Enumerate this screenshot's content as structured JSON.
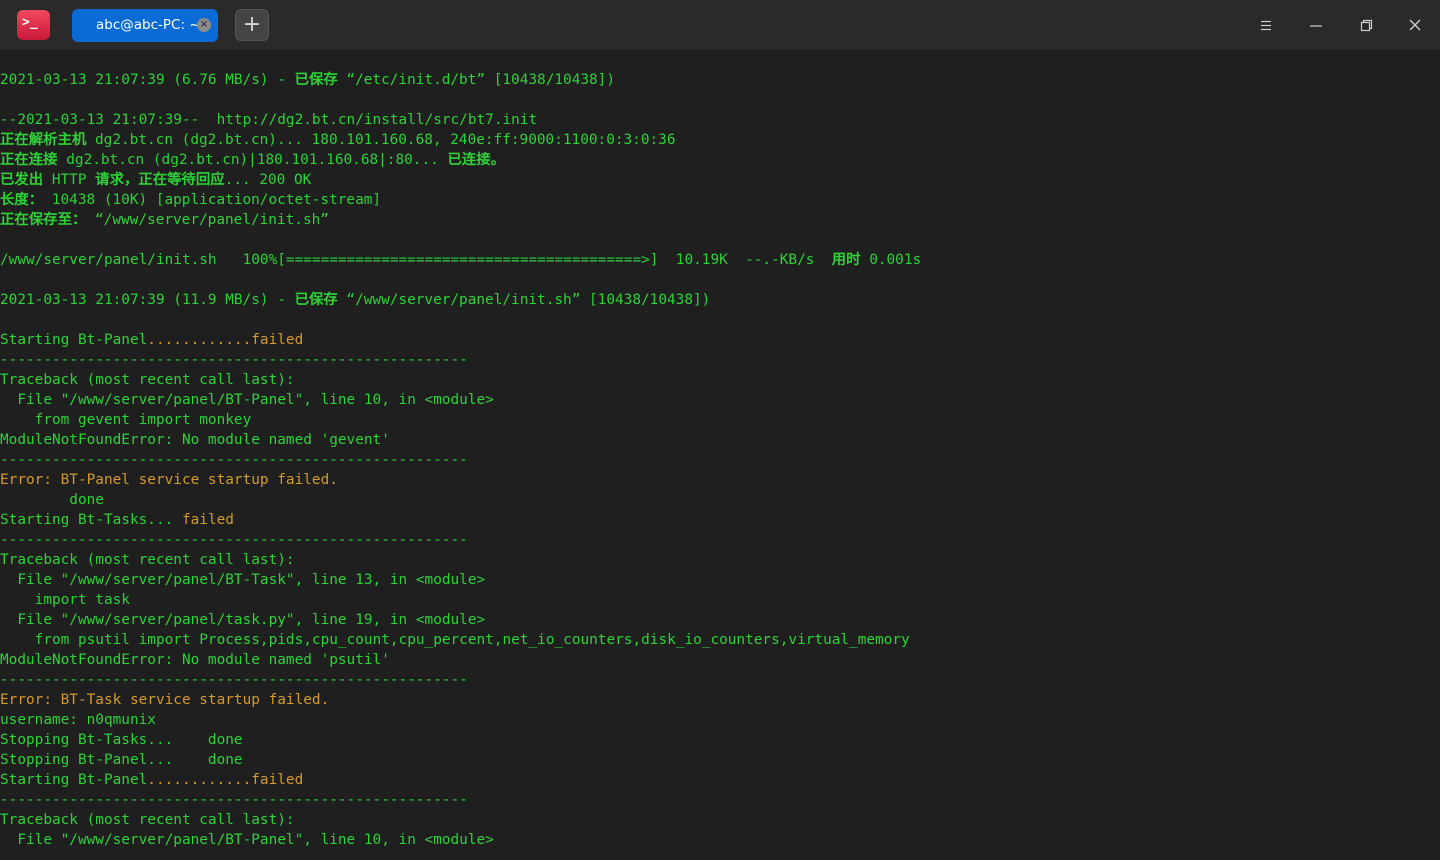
{
  "window": {
    "tab_title": "abc@abc-PC: ~",
    "tab_close_glyph": "×",
    "add_tab_glyph": "+",
    "app_icon_glyph": ">_",
    "colors": {
      "tab_active": "#0b6bd6",
      "terminal_bg": "#1f1f1f",
      "text_green": "#2dd237",
      "text_orange": "#d39a2a"
    }
  },
  "terminal": {
    "lines": [
      [],
      [
        {
          "t": "2021-03-13 21:07:39 (6.76 MB/s) - "
        },
        {
          "t": "已保存",
          "b": 1
        },
        {
          "t": " “/etc/init.d/bt” [10438/10438])"
        }
      ],
      [],
      [
        {
          "t": "--2021-03-13 21:07:39--  http://dg2.bt.cn/install/src/bt7.init"
        }
      ],
      [
        {
          "t": "正在解析主机",
          "b": 1
        },
        {
          "t": " dg2.bt.cn (dg2.bt.cn)... 180.101.160.68, 240e:ff:9000:1100:0:3:0:36"
        }
      ],
      [
        {
          "t": "正在连接",
          "b": 1
        },
        {
          "t": " dg2.bt.cn (dg2.bt.cn)|180.101.160.68|:80... "
        },
        {
          "t": "已连接。",
          "b": 1
        }
      ],
      [
        {
          "t": "已发出",
          "b": 1
        },
        {
          "t": " HTTP "
        },
        {
          "t": "请求，正在等待回应",
          "b": 1
        },
        {
          "t": "... 200 OK"
        }
      ],
      [
        {
          "t": "长度：",
          "b": 1
        },
        {
          "t": " 10438 (10K) [application/octet-stream]"
        }
      ],
      [
        {
          "t": "正在保存至：",
          "b": 1
        },
        {
          "t": " “/www/server/panel/init.sh”"
        }
      ],
      [],
      [
        {
          "t": "/www/server/panel/init.sh   100%[=========================================>]  10.19K  --.-KB/s  "
        },
        {
          "t": "用时",
          "b": 1
        },
        {
          "t": " 0.001s"
        }
      ],
      [],
      [
        {
          "t": "2021-03-13 21:07:39 (11.9 MB/s) - "
        },
        {
          "t": "已保存",
          "b": 1
        },
        {
          "t": " “/www/server/panel/init.sh” [10438/10438])"
        }
      ],
      [],
      [
        {
          "t": "Starting Bt-Panel"
        },
        {
          "t": "............failed",
          "c": "o"
        }
      ],
      [
        {
          "t": "------------------------------------------------------"
        }
      ],
      [
        {
          "t": "Traceback (most recent call last):"
        }
      ],
      [
        {
          "t": "  File \"/www/server/panel/BT-Panel\", line 10, in <module>"
        }
      ],
      [
        {
          "t": "    from gevent import monkey"
        }
      ],
      [
        {
          "t": "ModuleNotFoundError: No module named 'gevent'"
        }
      ],
      [
        {
          "t": "------------------------------------------------------"
        }
      ],
      [
        {
          "t": "Error: BT-Panel service startup failed.",
          "c": "o"
        }
      ],
      [
        {
          "t": "        done"
        }
      ],
      [
        {
          "t": "Starting Bt-Tasks... "
        },
        {
          "t": "failed",
          "c": "o"
        }
      ],
      [
        {
          "t": "------------------------------------------------------"
        }
      ],
      [
        {
          "t": "Traceback (most recent call last):"
        }
      ],
      [
        {
          "t": "  File \"/www/server/panel/BT-Task\", line 13, in <module>"
        }
      ],
      [
        {
          "t": "    import task"
        }
      ],
      [
        {
          "t": "  File \"/www/server/panel/task.py\", line 19, in <module>"
        }
      ],
      [
        {
          "t": "    from psutil import Process,pids,cpu_count,cpu_percent,net_io_counters,disk_io_counters,virtual_memory"
        }
      ],
      [
        {
          "t": "ModuleNotFoundError: No module named 'psutil'"
        }
      ],
      [
        {
          "t": "------------------------------------------------------"
        }
      ],
      [
        {
          "t": "Error: BT-Task service startup failed.",
          "c": "o"
        }
      ],
      [
        {
          "t": "username: n0qmunix"
        }
      ],
      [
        {
          "t": "Stopping Bt-Tasks...    done"
        }
      ],
      [
        {
          "t": "Stopping Bt-Panel...    done"
        }
      ],
      [
        {
          "t": "Starting Bt-Panel"
        },
        {
          "t": "............failed",
          "c": "o"
        }
      ],
      [
        {
          "t": "------------------------------------------------------"
        }
      ],
      [
        {
          "t": "Traceback (most recent call last):"
        }
      ],
      [
        {
          "t": "  File \"/www/server/panel/BT-Panel\", line 10, in <module>"
        }
      ]
    ]
  }
}
